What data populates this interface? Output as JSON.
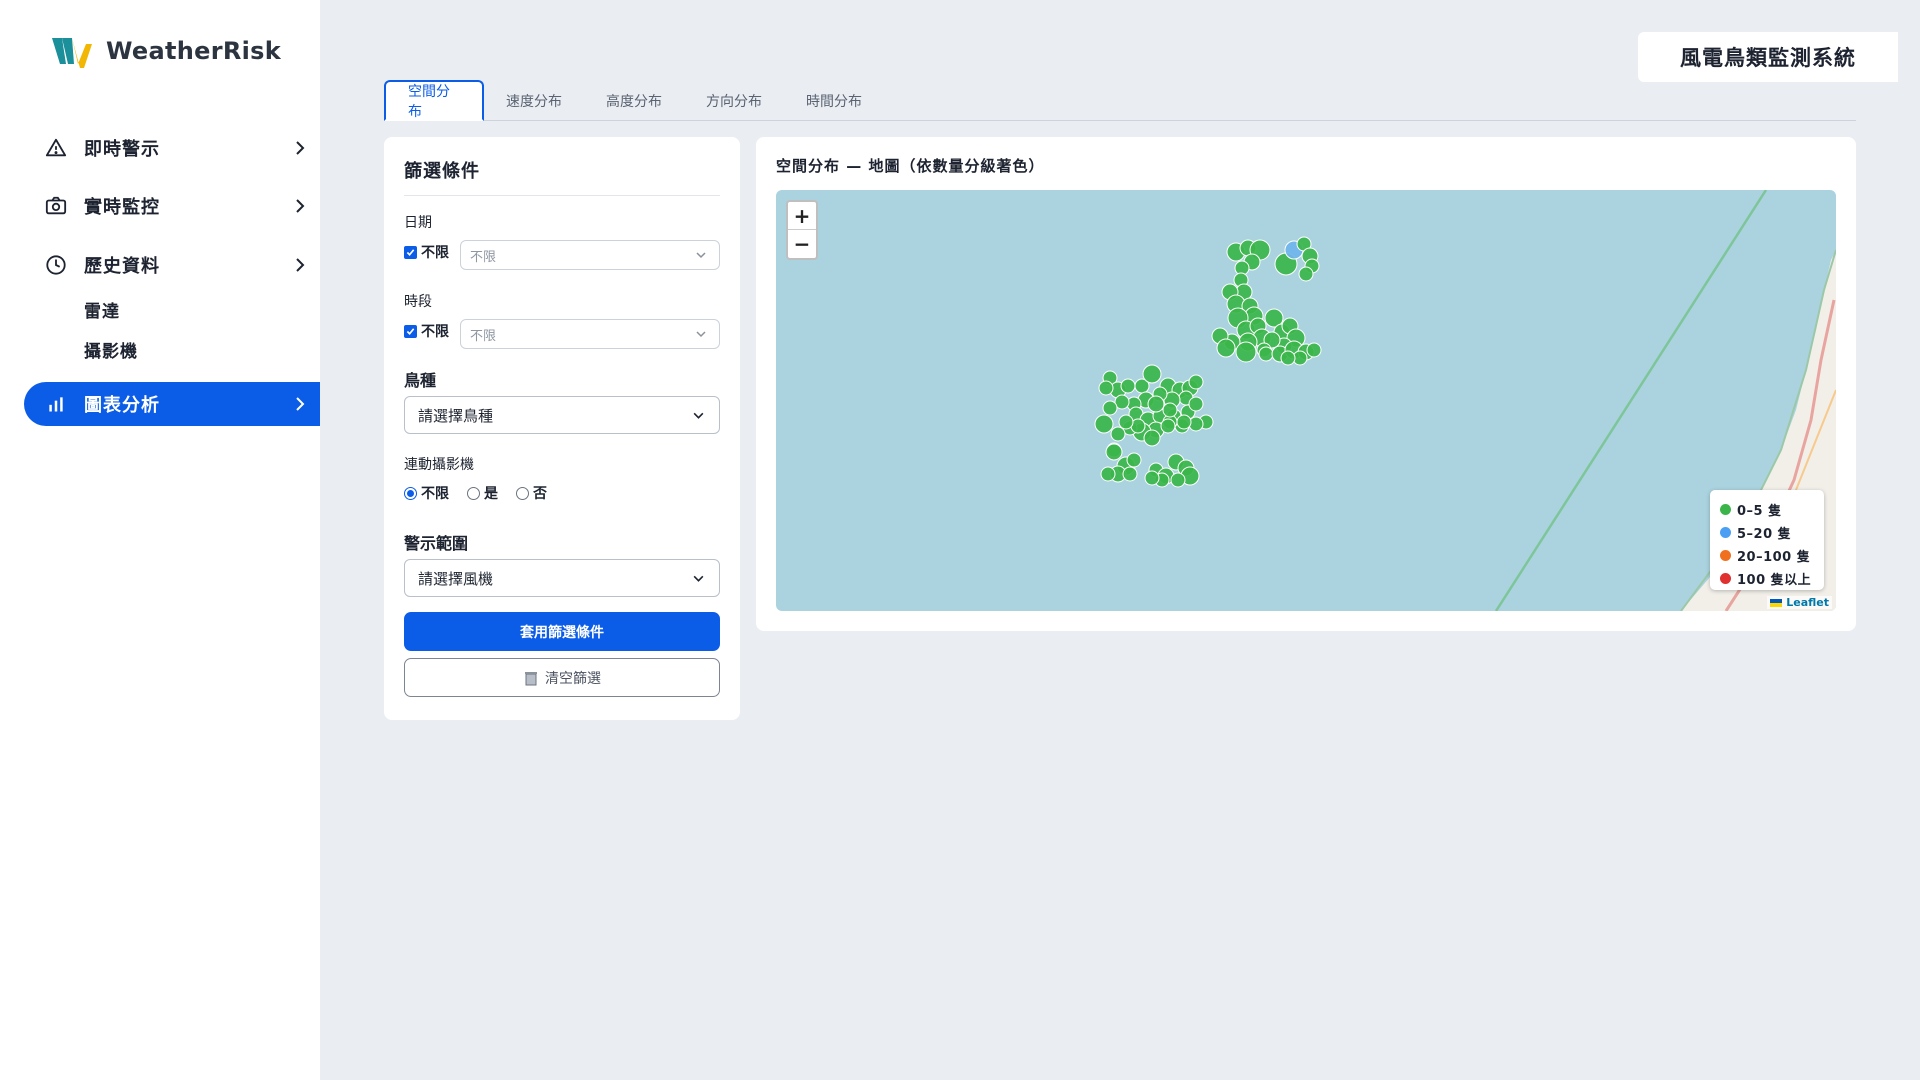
{
  "brand": {
    "name": "WeatherRisk"
  },
  "header": {
    "system_title": "風電鳥類監測系統"
  },
  "sidebar": {
    "items": [
      {
        "label": "即時警示",
        "icon": "warning-icon"
      },
      {
        "label": "實時監控",
        "icon": "camera-icon"
      },
      {
        "label": "歷史資料",
        "icon": "clock-icon"
      },
      {
        "label": "圖表分析",
        "icon": "bar-chart-icon"
      }
    ],
    "sub_items": [
      {
        "label": "雷達"
      },
      {
        "label": "攝影機"
      }
    ]
  },
  "tabs": [
    {
      "label": "空間分布",
      "active": true
    },
    {
      "label": "速度分布"
    },
    {
      "label": "高度分布"
    },
    {
      "label": "方向分布"
    },
    {
      "label": "時間分布"
    }
  ],
  "filter": {
    "title": "篩選條件",
    "date": {
      "label": "日期",
      "checkbox_label": "不限",
      "placeholder": "不限"
    },
    "period": {
      "label": "時段",
      "checkbox_label": "不限",
      "placeholder": "不限"
    },
    "species": {
      "label": "鳥種",
      "value": "請選擇鳥種"
    },
    "linked_camera": {
      "label": "連動攝影機",
      "options": [
        "不限",
        "是",
        "否"
      ],
      "selected": "不限"
    },
    "alert_range": {
      "label": "警示範圍",
      "value": "請選擇風機"
    },
    "apply_label": "套用篩選條件",
    "clear_label": "清空篩選"
  },
  "map": {
    "title": "空間分布 — 地圖（依數量分級著色）",
    "zoom_in": "+",
    "zoom_out": "−",
    "legend": [
      {
        "label": "0–5 隻",
        "color": "#3bb54a"
      },
      {
        "label": "5–20 隻",
        "color": "#4a9ff5"
      },
      {
        "label": "20–100 隻",
        "color": "#f07020"
      },
      {
        "label": "100 隻以上",
        "color": "#e03030"
      }
    ],
    "attribution": "Leaflet",
    "marker_colors": {
      "low": "#3bb54a",
      "mid": "#6fb4ec"
    }
  }
}
